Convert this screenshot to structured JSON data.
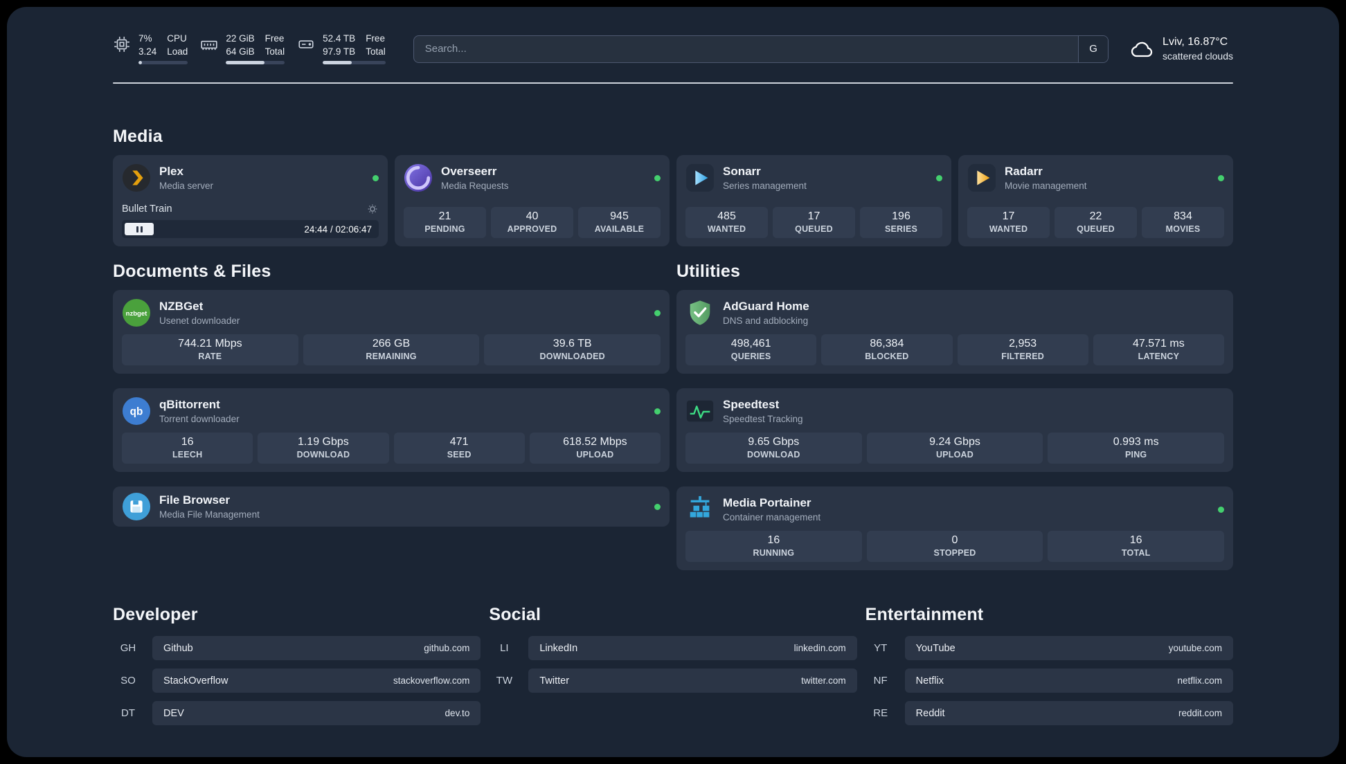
{
  "topbar": {
    "cpu": {
      "icon": "cpu-icon",
      "value_top": "7%",
      "value_bottom": "3.24",
      "label_top": "CPU",
      "label_bottom": "Load",
      "bar_percent": 7
    },
    "ram": {
      "icon": "ram-icon",
      "value_top": "22 GiB",
      "value_bottom": "64 GiB",
      "label_top": "Free",
      "label_bottom": "Total",
      "bar_percent": 66
    },
    "disk": {
      "icon": "disk-icon",
      "value_top": "52.4 TB",
      "value_bottom": "97.9 TB",
      "label_top": "Free",
      "label_bottom": "Total",
      "bar_percent": 46
    },
    "search": {
      "placeholder": "Search...",
      "engine_button": "G"
    },
    "weather": {
      "icon": "cloud-icon",
      "location_temp": "Lviv, 16.87°C",
      "condition": "scattered clouds"
    }
  },
  "sections": {
    "media": "Media",
    "documents": "Documents & Files",
    "utilities": "Utilities",
    "developer": "Developer",
    "social": "Social",
    "entertainment": "Entertainment"
  },
  "apps": {
    "plex": {
      "icon": "plex-icon",
      "name": "Plex",
      "subtitle": "Media server",
      "status": "online",
      "now_playing": {
        "title": "Bullet Train",
        "time": "24:44 / 02:06:47",
        "state": "paused",
        "progress_percent": 13
      }
    },
    "overseerr": {
      "icon": "overseerr-icon",
      "name": "Overseerr",
      "subtitle": "Media Requests",
      "status": "online",
      "stats": [
        {
          "value": "21",
          "label": "PENDING"
        },
        {
          "value": "40",
          "label": "APPROVED"
        },
        {
          "value": "945",
          "label": "AVAILABLE"
        }
      ]
    },
    "sonarr": {
      "icon": "sonarr-icon",
      "name": "Sonarr",
      "subtitle": "Series management",
      "status": "online",
      "stats": [
        {
          "value": "485",
          "label": "WANTED"
        },
        {
          "value": "17",
          "label": "QUEUED"
        },
        {
          "value": "196",
          "label": "SERIES"
        }
      ]
    },
    "radarr": {
      "icon": "radarr-icon",
      "name": "Radarr",
      "subtitle": "Movie management",
      "status": "online",
      "stats": [
        {
          "value": "17",
          "label": "WANTED"
        },
        {
          "value": "22",
          "label": "QUEUED"
        },
        {
          "value": "834",
          "label": "MOVIES"
        }
      ]
    },
    "nzbget": {
      "icon": "nzbget-icon",
      "name": "NZBGet",
      "subtitle": "Usenet downloader",
      "status": "online",
      "stats": [
        {
          "value": "744.21 Mbps",
          "label": "RATE"
        },
        {
          "value": "266 GB",
          "label": "REMAINING"
        },
        {
          "value": "39.6 TB",
          "label": "DOWNLOADED"
        }
      ]
    },
    "qbittorrent": {
      "icon": "qbittorrent-icon",
      "name": "qBittorrent",
      "subtitle": "Torrent downloader",
      "status": "online",
      "stats": [
        {
          "value": "16",
          "label": "LEECH"
        },
        {
          "value": "1.19 Gbps",
          "label": "DOWNLOAD"
        },
        {
          "value": "471",
          "label": "SEED"
        },
        {
          "value": "618.52 Mbps",
          "label": "UPLOAD"
        }
      ]
    },
    "filebrowser": {
      "icon": "filebrowser-icon",
      "name": "File Browser",
      "subtitle": "Media File Management",
      "status": "online"
    },
    "adguard": {
      "icon": "adguard-icon",
      "name": "AdGuard Home",
      "subtitle": "DNS and adblocking",
      "stats": [
        {
          "value": "498,461",
          "label": "QUERIES"
        },
        {
          "value": "86,384",
          "label": "BLOCKED"
        },
        {
          "value": "2,953",
          "label": "FILTERED"
        },
        {
          "value": "47.571 ms",
          "label": "LATENCY"
        }
      ]
    },
    "speedtest": {
      "icon": "speedtest-icon",
      "name": "Speedtest",
      "subtitle": "Speedtest Tracking",
      "stats": [
        {
          "value": "9.65 Gbps",
          "label": "DOWNLOAD"
        },
        {
          "value": "9.24 Gbps",
          "label": "UPLOAD"
        },
        {
          "value": "0.993 ms",
          "label": "PING"
        }
      ]
    },
    "portainer": {
      "icon": "portainer-icon",
      "name": "Media Portainer",
      "subtitle": "Container management",
      "status": "online",
      "stats": [
        {
          "value": "16",
          "label": "RUNNING"
        },
        {
          "value": "0",
          "label": "STOPPED"
        },
        {
          "value": "16",
          "label": "TOTAL"
        }
      ]
    }
  },
  "bookmarks": {
    "developer": [
      {
        "tag": "GH",
        "name": "Github",
        "url": "github.com"
      },
      {
        "tag": "SO",
        "name": "StackOverflow",
        "url": "stackoverflow.com"
      },
      {
        "tag": "DT",
        "name": "DEV",
        "url": "dev.to"
      }
    ],
    "social": [
      {
        "tag": "LI",
        "name": "LinkedIn",
        "url": "linkedin.com"
      },
      {
        "tag": "TW",
        "name": "Twitter",
        "url": "twitter.com"
      }
    ],
    "entertainment": [
      {
        "tag": "YT",
        "name": "YouTube",
        "url": "youtube.com"
      },
      {
        "tag": "NF",
        "name": "Netflix",
        "url": "netflix.com"
      },
      {
        "tag": "RE",
        "name": "Reddit",
        "url": "reddit.com"
      }
    ]
  },
  "colors": {
    "background": "#1b2534",
    "card": "#2a3445",
    "tile": "#323d50",
    "status_online": "#44cf6e",
    "plex_accent": "#e5a00d",
    "overseerr_accent": "#6c5ce7",
    "sonarr_accent": "#2b9fe3",
    "radarr_accent": "#f5a623",
    "nzbget_accent": "#4aa13c",
    "qbittorrent_accent": "#3d7dd1",
    "filebrowser_accent": "#3f9fd8",
    "adguard_accent": "#68b277",
    "speedtest_accent": "#3ddc84",
    "portainer_accent": "#33a7dc"
  }
}
